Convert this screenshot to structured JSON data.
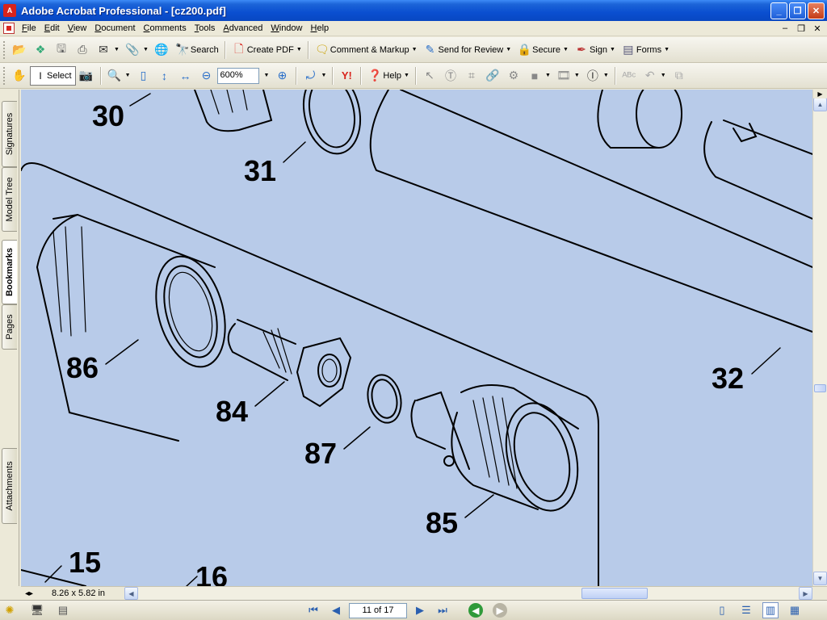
{
  "window": {
    "title": "Adobe Acrobat Professional - [cz200.pdf]",
    "minimize_label": "_",
    "restore_label": "❐",
    "close_label": "✕"
  },
  "menubar": {
    "items": [
      "File",
      "Edit",
      "View",
      "Document",
      "Comments",
      "Tools",
      "Advanced",
      "Window",
      "Help"
    ],
    "mdi_minimize": "–",
    "mdi_restore": "❐",
    "mdi_close": "✕"
  },
  "toolbar1": {
    "search_label": "Search",
    "create_pdf_label": "Create PDF",
    "comment_markup_label": "Comment & Markup",
    "send_review_label": "Send for Review",
    "secure_label": "Secure",
    "sign_label": "Sign",
    "forms_label": "Forms"
  },
  "toolbar2": {
    "select_label": "Select",
    "zoom_value": "600%",
    "help_label": "Help"
  },
  "navtabs": [
    "Signatures",
    "Model Tree",
    "Bookmarks",
    "Pages",
    "Attachments"
  ],
  "drawing": {
    "callouts": [
      "30",
      "31",
      "86",
      "84",
      "87",
      "85",
      "32",
      "15",
      "16"
    ]
  },
  "status": {
    "page_size": "8.26 x 5.82 in",
    "page_indicator": "11 of 17"
  },
  "colors": {
    "doc_background": "#b8cbe9",
    "titlebar": "#0a4fd0"
  }
}
